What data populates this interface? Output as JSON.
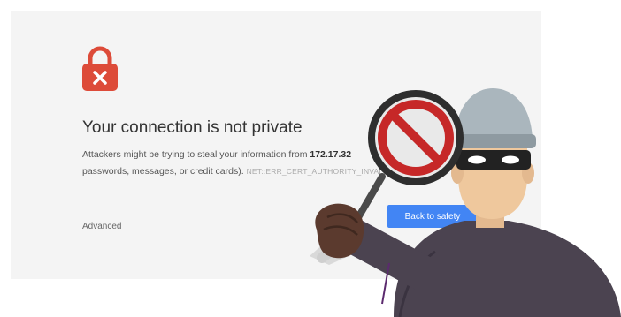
{
  "interstitial": {
    "title": "Your connection is not private",
    "line1_prefix": "Attackers might be trying to steal your information from ",
    "host": "172.17.32",
    "line2_text": "passwords, messages, or credit cards).",
    "error_code": "NET::ERR_CERT_AUTHORITY_INVALID",
    "advanced_label": "Advanced",
    "back_button_label": "Back to safety"
  },
  "icons": {
    "lock": "lock-error-icon",
    "no_sign": "no-entry-magnifier-icon",
    "thief": "masked-thief-illustration"
  },
  "colors": {
    "panel_bg": "#f4f4f4",
    "lock_red": "#dd4b39",
    "button_blue": "#4285f4",
    "no_sign_red": "#c62828",
    "thief_coat": "#4b4350"
  }
}
